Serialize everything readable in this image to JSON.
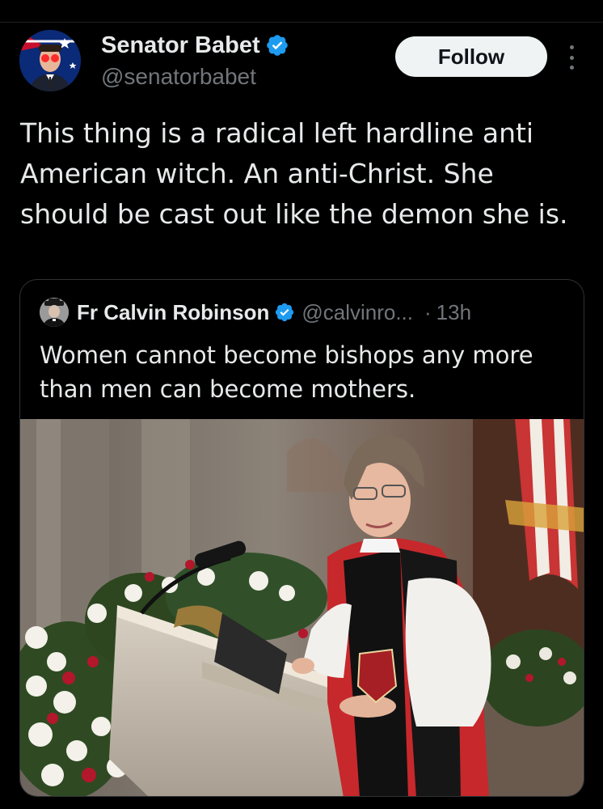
{
  "post": {
    "author": {
      "name": "Senator Babet",
      "handle": "@senatorbabet",
      "verified": true
    },
    "follow_label": "Follow",
    "text": "This thing is a radical left hardline anti American witch. An anti-Christ. She should be cast out like the demon she is."
  },
  "quoted_post": {
    "author": {
      "name": "Fr Calvin Robinson",
      "handle": "@calvinro...",
      "verified": true
    },
    "separator": "·",
    "time": "13h",
    "text": "Women cannot become bishops any more than men can become mothers."
  },
  "colors": {
    "background": "#000000",
    "text_primary": "#e7e9ea",
    "text_secondary": "#71767b",
    "verified_blue": "#1d9bf0",
    "follow_button_bg": "#eff3f4",
    "border": "#2f3336"
  },
  "icons": {
    "verified": "verified-badge-icon",
    "more": "more-vertical-icon"
  }
}
